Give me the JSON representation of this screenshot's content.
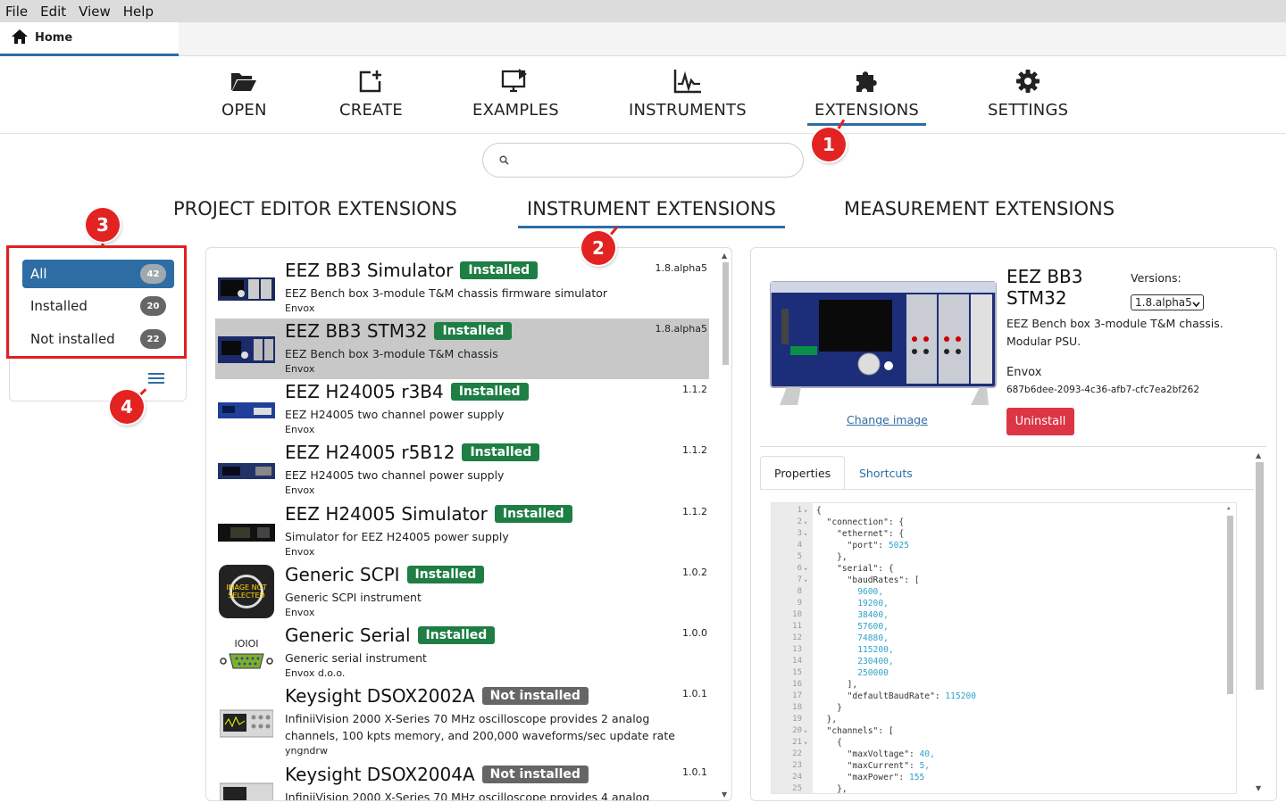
{
  "menu": [
    "File",
    "Edit",
    "View",
    "Help"
  ],
  "tab": {
    "home_label": "Home"
  },
  "nav": {
    "items": [
      {
        "label": "OPEN",
        "icon": "folder-open-icon"
      },
      {
        "label": "CREATE",
        "icon": "create-icon"
      },
      {
        "label": "EXAMPLES",
        "icon": "examples-icon"
      },
      {
        "label": "INSTRUMENTS",
        "icon": "instruments-icon"
      },
      {
        "label": "EXTENSIONS",
        "icon": "puzzle-icon",
        "active": true
      },
      {
        "label": "SETTINGS",
        "icon": "gear-icon"
      }
    ]
  },
  "search": {
    "placeholder": "",
    "icon": "search-icon"
  },
  "section_tabs": [
    {
      "label": "PROJECT EDITOR EXTENSIONS"
    },
    {
      "label": "INSTRUMENT EXTENSIONS",
      "active": true
    },
    {
      "label": "MEASUREMENT EXTENSIONS"
    }
  ],
  "filters": [
    {
      "label": "All",
      "count": "42",
      "active": true
    },
    {
      "label": "Installed",
      "count": "20"
    },
    {
      "label": "Not installed",
      "count": "22"
    }
  ],
  "filter_menu_icon": "hamburger-icon",
  "markers": [
    "1",
    "2",
    "3",
    "4"
  ],
  "extensions": [
    {
      "name": "EEZ BB3 Simulator",
      "status": "Installed",
      "desc": "EEZ Bench box 3-module T&M chassis firmware simulator",
      "author": "Envox",
      "version": "1.8.alpha5"
    },
    {
      "name": "EEZ BB3 STM32",
      "status": "Installed",
      "desc": "EEZ Bench box 3-module T&M chassis",
      "author": "Envox",
      "version": "1.8.alpha5",
      "selected": true
    },
    {
      "name": "EEZ H24005 r3B4",
      "status": "Installed",
      "desc": "EEZ H24005 two channel power supply",
      "author": "Envox",
      "version": "1.1.2"
    },
    {
      "name": "EEZ H24005 r5B12",
      "status": "Installed",
      "desc": "EEZ H24005 two channel power supply",
      "author": "Envox",
      "version": "1.1.2"
    },
    {
      "name": "EEZ H24005 Simulator",
      "status": "Installed",
      "desc": "Simulator for EEZ H24005 power supply",
      "author": "Envox",
      "version": "1.1.2"
    },
    {
      "name": "Generic SCPI",
      "status": "Installed",
      "desc": "Generic SCPI instrument",
      "author": "Envox",
      "version": "1.0.2",
      "thumb_text": "IMAGE NOT SELECTED"
    },
    {
      "name": "Generic Serial",
      "status": "Installed",
      "desc": "Generic serial instrument",
      "author": "Envox d.o.o.",
      "version": "1.0.0",
      "thumb_text": "IOIOI"
    },
    {
      "name": "Keysight DSOX2002A",
      "status": "Not installed",
      "desc": "InfiniiVision 2000 X-Series 70 MHz oscilloscope provides 2 analog channels, 100 kpts memory, and 200,000 waveforms/sec update rate",
      "author": "yngndrw",
      "version": "1.0.1"
    },
    {
      "name": "Keysight DSOX2004A",
      "status": "Not installed",
      "desc": "InfiniiVision 2000 X-Series 70 MHz oscilloscope provides 4 analog channels, 100",
      "author": "",
      "version": "1.0.1"
    }
  ],
  "detail": {
    "name_line1": "EEZ BB3",
    "name_line2": "STM32",
    "versions_label": "Versions:",
    "version_selected": "1.8.alpha5",
    "desc": "EEZ Bench box 3-module T&M chassis. Modular PSU.",
    "author": "Envox",
    "id": "687b6dee-2093-4c36-afb7-cfc7ea2bf262",
    "uninstall_label": "Uninstall",
    "change_image_label": "Change image",
    "tabs": [
      "Properties",
      "Shortcuts"
    ]
  },
  "code": {
    "lines": [
      {
        "n": "1",
        "t": "{",
        "f": true
      },
      {
        "n": "2",
        "t": "  \"connection\": {",
        "f": true
      },
      {
        "n": "3",
        "t": "    \"ethernet\": {",
        "f": true
      },
      {
        "n": "4",
        "t": "      \"port\": ",
        "v": "5025"
      },
      {
        "n": "5",
        "t": "    },"
      },
      {
        "n": "6",
        "t": "    \"serial\": {",
        "f": true
      },
      {
        "n": "7",
        "t": "      \"baudRates\": [",
        "f": true
      },
      {
        "n": "8",
        "t": "        ",
        "v": "9600,"
      },
      {
        "n": "9",
        "t": "        ",
        "v": "19200,"
      },
      {
        "n": "10",
        "t": "        ",
        "v": "38400,"
      },
      {
        "n": "11",
        "t": "        ",
        "v": "57600,"
      },
      {
        "n": "12",
        "t": "        ",
        "v": "74880,"
      },
      {
        "n": "13",
        "t": "        ",
        "v": "115200,"
      },
      {
        "n": "14",
        "t": "        ",
        "v": "230400,"
      },
      {
        "n": "15",
        "t": "        ",
        "v": "250000"
      },
      {
        "n": "16",
        "t": "      ],"
      },
      {
        "n": "17",
        "t": "      \"defaultBaudRate\": ",
        "v": "115200"
      },
      {
        "n": "18",
        "t": "    }"
      },
      {
        "n": "19",
        "t": "  },"
      },
      {
        "n": "20",
        "t": "  \"channels\": [",
        "f": true
      },
      {
        "n": "21",
        "t": "    {",
        "f": true
      },
      {
        "n": "22",
        "t": "      \"maxVoltage\": ",
        "v": "40,"
      },
      {
        "n": "23",
        "t": "      \"maxCurrent\": ",
        "v": "5,"
      },
      {
        "n": "24",
        "t": "      \"maxPower\": ",
        "v": "155"
      },
      {
        "n": "25",
        "t": "    },"
      }
    ]
  },
  "colors": {
    "accent": "#2e6da4",
    "installed": "#1e7e44",
    "not_installed": "#666666",
    "danger": "#dc3545",
    "marker": "#e32222"
  }
}
